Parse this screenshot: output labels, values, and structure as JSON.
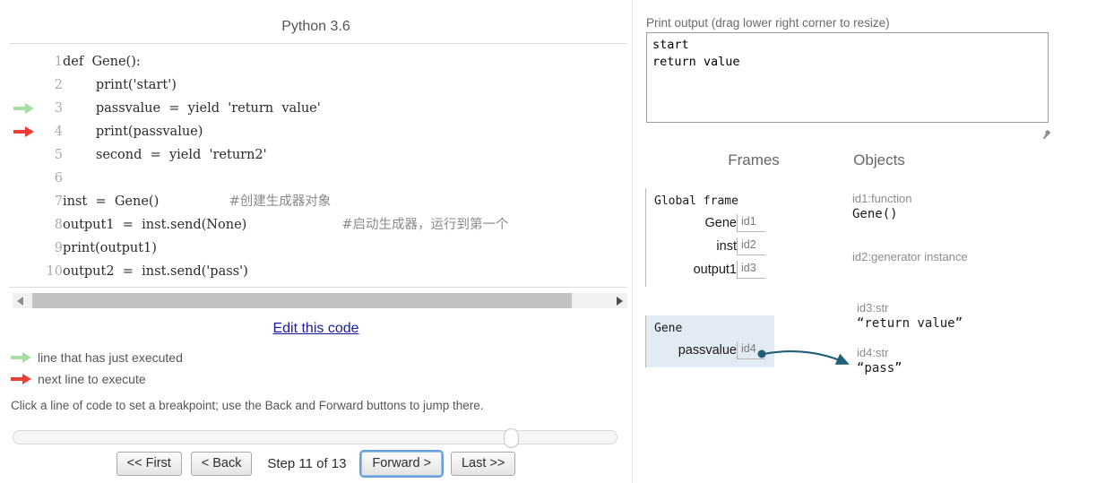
{
  "left": {
    "language_title": "Python 3.6",
    "code_lines": [
      {
        "n": "1",
        "text": "def  Gene():",
        "arrow": "",
        "comment": ""
      },
      {
        "n": "2",
        "text": "        print('start')",
        "arrow": "",
        "comment": ""
      },
      {
        "n": "3",
        "text": "        passvalue  =  yield  'return  value'",
        "arrow": "green",
        "comment": ""
      },
      {
        "n": "4",
        "text": "        print(passvalue)",
        "arrow": "red",
        "comment": ""
      },
      {
        "n": "5",
        "text": "        second  =  yield  'return2'",
        "arrow": "",
        "comment": ""
      },
      {
        "n": "6",
        "text": "",
        "arrow": "",
        "comment": ""
      },
      {
        "n": "7",
        "text": "inst  =  Gene()",
        "arrow": "",
        "comment": "#创建生成器对象"
      },
      {
        "n": "8",
        "text": "output1  =  inst.send(None)",
        "arrow": "",
        "comment": "#启动生成器，运行到第一个"
      },
      {
        "n": "9",
        "text": "print(output1)",
        "arrow": "",
        "comment": ""
      },
      {
        "n": "10",
        "text": "output2  =  inst.send('pass')",
        "arrow": "",
        "comment": ""
      }
    ],
    "edit_link_label": "Edit this code",
    "legend": {
      "executed": "line that has just executed",
      "next": "next line to execute"
    },
    "breakpoint_hint": "Click a line of code to set a breakpoint; use the Back and Forward buttons to jump there.",
    "controls": {
      "first_label": "<< First",
      "back_label": "< Back",
      "step_label": "Step 11 of 13",
      "forward_label": "Forward >",
      "last_label": "Last >>",
      "current_step": 11,
      "total_steps": 13
    },
    "colors": {
      "executed_arrow": "#a5dfa5",
      "next_arrow": "#e93f34",
      "link": "#1919a5",
      "focus_ring": "#63a1e0"
    }
  },
  "right": {
    "print_output_label": "Print output (drag lower right corner to resize)",
    "print_output_text": "start\nreturn value",
    "frames_heading": "Frames",
    "objects_heading": "Objects",
    "frames": [
      {
        "title": "Global frame",
        "highlighted": false,
        "vars": [
          {
            "name": "Gene",
            "value": "id1"
          },
          {
            "name": "inst",
            "value": "id2"
          },
          {
            "name": "output1",
            "value": "id3"
          }
        ]
      },
      {
        "title": "Gene",
        "highlighted": true,
        "vars": [
          {
            "name": "passvalue",
            "value": "id4"
          }
        ]
      }
    ],
    "objects": [
      {
        "type": "id1:function",
        "value": "Gene()"
      },
      {
        "type": "id2:generator instance",
        "value": ""
      },
      {
        "type": "id3:str",
        "value": "“return  value”"
      },
      {
        "type": "id4:str",
        "value": "“pass”"
      }
    ],
    "colors": {
      "highlight_frame_bg": "#e2eaf4",
      "connector_arrow": "#1f6079"
    }
  }
}
